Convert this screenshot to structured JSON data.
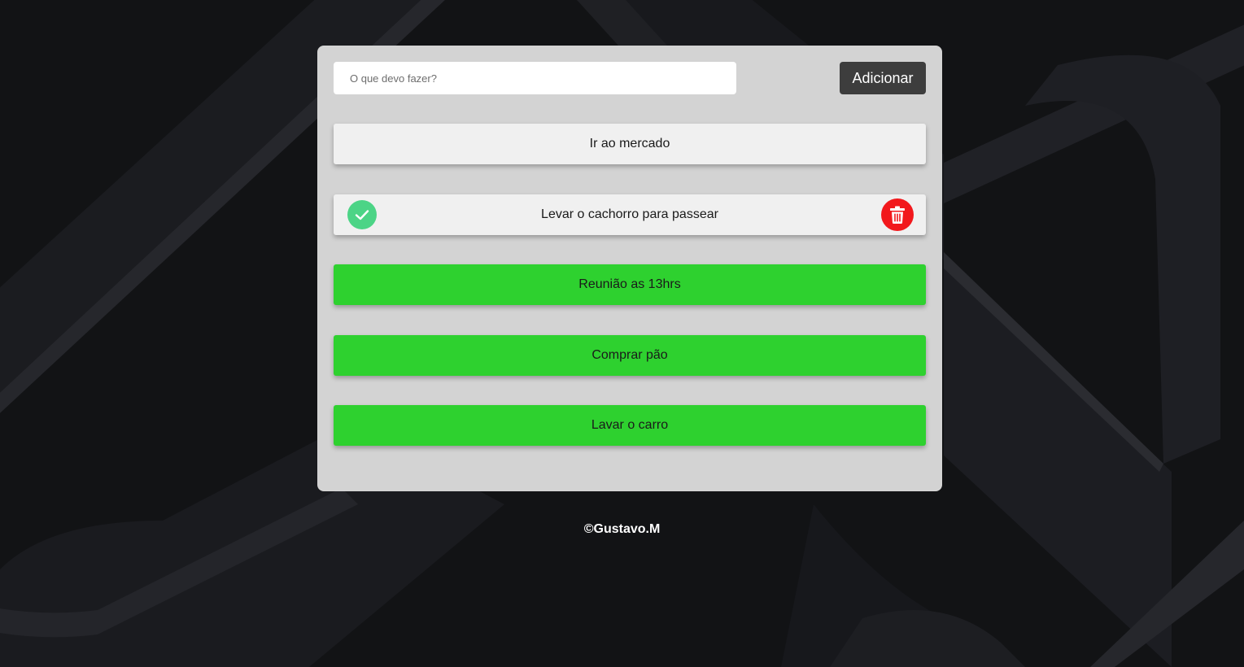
{
  "form": {
    "placeholder": "O que devo fazer?",
    "add_label": "Adicionar"
  },
  "tasks": [
    {
      "label": "Ir ao mercado",
      "done": false
    },
    {
      "label": "Levar o cachorro para passear",
      "done": false,
      "hovered": true
    },
    {
      "label": "Reunião as 13hrs",
      "done": true
    },
    {
      "label": "Comprar pão",
      "done": true
    },
    {
      "label": "Lavar o carro",
      "done": true
    }
  ],
  "colors": {
    "done_bg": "#2ed12f",
    "pending_bg": "#f0f0f0",
    "check_icon": "#4cd486",
    "trash_icon": "#f2181c"
  },
  "icons": {
    "complete": "check-circle-icon",
    "delete": "trash-icon"
  },
  "footer": {
    "credit": "©Gustavo.M"
  }
}
